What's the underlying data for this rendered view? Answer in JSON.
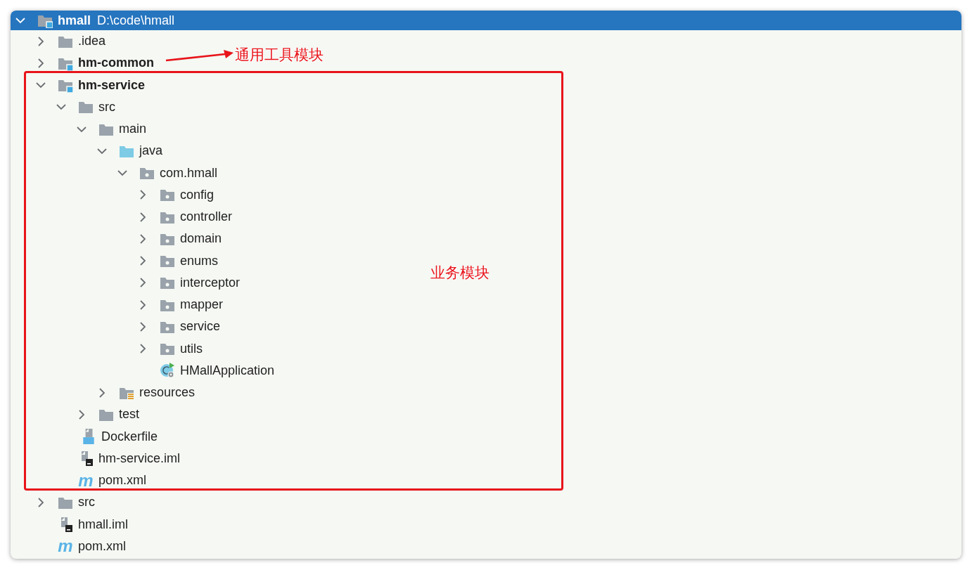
{
  "project_tree": {
    "root": {
      "name": "hmall",
      "path": "D:\\code\\hmall",
      "kind": "module",
      "selected": true,
      "expanded": true,
      "children": [
        {
          "name": ".idea",
          "kind": "folder",
          "selected": false,
          "expanded": false
        },
        {
          "name": "hm-common",
          "kind": "module",
          "selected": false,
          "expanded": false
        },
        {
          "name": "hm-service",
          "kind": "module",
          "selected": false,
          "expanded": true,
          "children": [
            {
              "name": "src",
              "kind": "folder",
              "selected": false,
              "expanded": true,
              "children": [
                {
                  "name": "main",
                  "kind": "folder",
                  "selected": false,
                  "expanded": true,
                  "children": [
                    {
                      "name": "java",
                      "kind": "source-folder",
                      "selected": false,
                      "expanded": true,
                      "children": [
                        {
                          "name": "com.hmall",
                          "kind": "package",
                          "selected": false,
                          "expanded": true,
                          "children": [
                            {
                              "name": "config",
                              "kind": "package",
                              "selected": false,
                              "expanded": false
                            },
                            {
                              "name": "controller",
                              "kind": "package",
                              "selected": false,
                              "expanded": false
                            },
                            {
                              "name": "domain",
                              "kind": "package",
                              "selected": false,
                              "expanded": false
                            },
                            {
                              "name": "enums",
                              "kind": "package",
                              "selected": false,
                              "expanded": false
                            },
                            {
                              "name": "interceptor",
                              "kind": "package",
                              "selected": false,
                              "expanded": false
                            },
                            {
                              "name": "mapper",
                              "kind": "package",
                              "selected": false,
                              "expanded": false
                            },
                            {
                              "name": "service",
                              "kind": "package",
                              "selected": false,
                              "expanded": false
                            },
                            {
                              "name": "utils",
                              "kind": "package",
                              "selected": false,
                              "expanded": false
                            },
                            {
                              "name": "HMallApplication",
                              "kind": "class",
                              "selected": false
                            }
                          ]
                        }
                      ]
                    },
                    {
                      "name": "resources",
                      "kind": "resources-folder",
                      "selected": false,
                      "expanded": false
                    }
                  ]
                },
                {
                  "name": "test",
                  "kind": "folder",
                  "selected": false,
                  "expanded": false
                }
              ]
            },
            {
              "name": "Dockerfile",
              "kind": "docker",
              "selected": false
            },
            {
              "name": "hm-service.iml",
              "kind": "iml",
              "selected": false
            },
            {
              "name": "pom.xml",
              "kind": "maven",
              "icon_text": "m",
              "selected": false
            }
          ]
        },
        {
          "name": "src",
          "kind": "folder",
          "selected": false,
          "expanded": false
        },
        {
          "name": "hmall.iml",
          "kind": "iml",
          "selected": false
        },
        {
          "name": "pom.xml",
          "kind": "maven",
          "icon_text": "m",
          "selected": false
        }
      ]
    }
  },
  "annotations": [
    {
      "kind": "arrow-callout",
      "text": "通用工具模块"
    },
    {
      "kind": "frame-callout",
      "text": "业务模块"
    }
  ]
}
